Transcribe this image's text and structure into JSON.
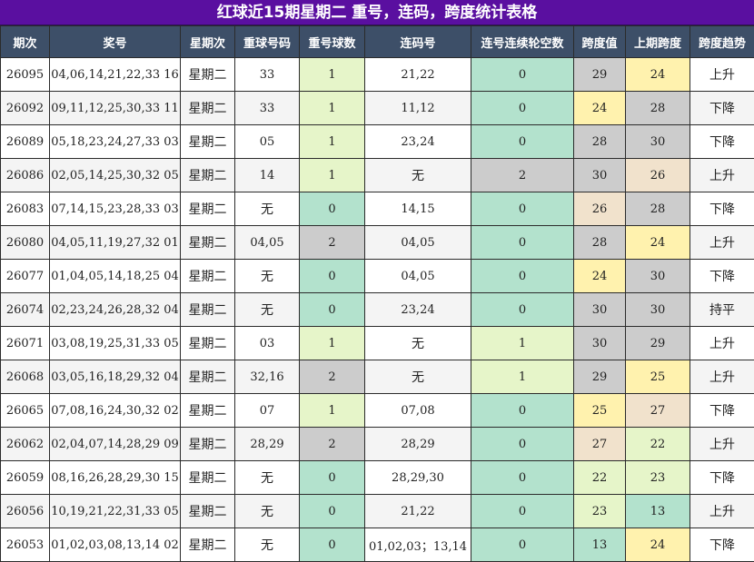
{
  "title": "红球近15期星期二 重号，连码，跨度统计表格",
  "headers": [
    "期次",
    "奖号",
    "星期次",
    "重球号码",
    "重号球数",
    "连码号",
    "连号连续轮空数",
    "跨度值",
    "上期跨度",
    "跨度趋势"
  ],
  "colors": {
    "title_bg": "#5a0fa0",
    "header_bg": "#3d4f68",
    "green": "#b3e2cd",
    "lime": "#e6f5c9",
    "gray": "#cccccc",
    "yellow": "#fff2ae",
    "peach": "#f1e2cc"
  },
  "rows": [
    {
      "issue": "26095",
      "numbers": "04,06,14,21,22,33 16",
      "weekday": "星期二",
      "repeat_nums": "33",
      "repeat_count": "1",
      "consec": "21,22",
      "miss": "0",
      "span": "29",
      "prev_span": "24",
      "trend": "上升",
      "c_count": "lime",
      "c_miss": "green",
      "c_span": "gray",
      "c_prev": "yellow"
    },
    {
      "issue": "26092",
      "numbers": "09,11,12,25,30,33 11",
      "weekday": "星期二",
      "repeat_nums": "33",
      "repeat_count": "1",
      "consec": "11,12",
      "miss": "0",
      "span": "24",
      "prev_span": "28",
      "trend": "下降",
      "c_count": "lime",
      "c_miss": "green",
      "c_span": "yellow",
      "c_prev": "gray"
    },
    {
      "issue": "26089",
      "numbers": "05,18,23,24,27,33 03",
      "weekday": "星期二",
      "repeat_nums": "05",
      "repeat_count": "1",
      "consec": "23,24",
      "miss": "0",
      "span": "28",
      "prev_span": "30",
      "trend": "下降",
      "c_count": "lime",
      "c_miss": "green",
      "c_span": "gray",
      "c_prev": "gray"
    },
    {
      "issue": "26086",
      "numbers": "02,05,14,25,30,32 05",
      "weekday": "星期二",
      "repeat_nums": "14",
      "repeat_count": "1",
      "consec": "无",
      "miss": "2",
      "span": "30",
      "prev_span": "26",
      "trend": "上升",
      "c_count": "lime",
      "c_miss": "gray",
      "c_span": "gray",
      "c_prev": "peach"
    },
    {
      "issue": "26083",
      "numbers": "07,14,15,23,28,33 03",
      "weekday": "星期二",
      "repeat_nums": "无",
      "repeat_count": "0",
      "consec": "14,15",
      "miss": "0",
      "span": "26",
      "prev_span": "28",
      "trend": "下降",
      "c_count": "green",
      "c_miss": "green",
      "c_span": "peach",
      "c_prev": "gray"
    },
    {
      "issue": "26080",
      "numbers": "04,05,11,19,27,32 01",
      "weekday": "星期二",
      "repeat_nums": "04,05",
      "repeat_count": "2",
      "consec": "04,05",
      "miss": "0",
      "span": "28",
      "prev_span": "24",
      "trend": "上升",
      "c_count": "gray",
      "c_miss": "green",
      "c_span": "gray",
      "c_prev": "yellow"
    },
    {
      "issue": "26077",
      "numbers": "01,04,05,14,18,25 04",
      "weekday": "星期二",
      "repeat_nums": "无",
      "repeat_count": "0",
      "consec": "04,05",
      "miss": "0",
      "span": "24",
      "prev_span": "30",
      "trend": "下降",
      "c_count": "green",
      "c_miss": "green",
      "c_span": "yellow",
      "c_prev": "gray"
    },
    {
      "issue": "26074",
      "numbers": "02,23,24,26,28,32 04",
      "weekday": "星期二",
      "repeat_nums": "无",
      "repeat_count": "0",
      "consec": "23,24",
      "miss": "0",
      "span": "30",
      "prev_span": "30",
      "trend": "持平",
      "c_count": "green",
      "c_miss": "green",
      "c_span": "gray",
      "c_prev": "gray"
    },
    {
      "issue": "26071",
      "numbers": "03,08,19,25,31,33 05",
      "weekday": "星期二",
      "repeat_nums": "03",
      "repeat_count": "1",
      "consec": "无",
      "miss": "1",
      "span": "30",
      "prev_span": "29",
      "trend": "上升",
      "c_count": "lime",
      "c_miss": "lime",
      "c_span": "gray",
      "c_prev": "gray"
    },
    {
      "issue": "26068",
      "numbers": "03,05,16,18,29,32 04",
      "weekday": "星期二",
      "repeat_nums": "32,16",
      "repeat_count": "2",
      "consec": "无",
      "miss": "1",
      "span": "29",
      "prev_span": "25",
      "trend": "上升",
      "c_count": "gray",
      "c_miss": "lime",
      "c_span": "gray",
      "c_prev": "yellow"
    },
    {
      "issue": "26065",
      "numbers": "07,08,16,24,30,32 02",
      "weekday": "星期二",
      "repeat_nums": "07",
      "repeat_count": "1",
      "consec": "07,08",
      "miss": "0",
      "span": "25",
      "prev_span": "27",
      "trend": "下降",
      "c_count": "lime",
      "c_miss": "green",
      "c_span": "yellow",
      "c_prev": "peach"
    },
    {
      "issue": "26062",
      "numbers": "02,04,07,14,28,29 09",
      "weekday": "星期二",
      "repeat_nums": "28,29",
      "repeat_count": "2",
      "consec": "28,29",
      "miss": "0",
      "span": "27",
      "prev_span": "22",
      "trend": "上升",
      "c_count": "gray",
      "c_miss": "green",
      "c_span": "peach",
      "c_prev": "lime"
    },
    {
      "issue": "26059",
      "numbers": "08,16,26,28,29,30 15",
      "weekday": "星期二",
      "repeat_nums": "无",
      "repeat_count": "0",
      "consec": "28,29,30",
      "miss": "0",
      "span": "22",
      "prev_span": "23",
      "trend": "下降",
      "c_count": "green",
      "c_miss": "green",
      "c_span": "lime",
      "c_prev": "lime"
    },
    {
      "issue": "26056",
      "numbers": "10,19,21,22,31,33 05",
      "weekday": "星期二",
      "repeat_nums": "无",
      "repeat_count": "0",
      "consec": "21,22",
      "miss": "0",
      "span": "23",
      "prev_span": "13",
      "trend": "上升",
      "c_count": "green",
      "c_miss": "green",
      "c_span": "lime",
      "c_prev": "green"
    },
    {
      "issue": "26053",
      "numbers": "01,02,03,08,13,14 02",
      "weekday": "星期二",
      "repeat_nums": "无",
      "repeat_count": "0",
      "consec": "01,02,03；13,14",
      "miss": "0",
      "span": "13",
      "prev_span": "24",
      "trend": "下降",
      "c_count": "green",
      "c_miss": "green",
      "c_span": "green",
      "c_prev": "yellow"
    }
  ]
}
